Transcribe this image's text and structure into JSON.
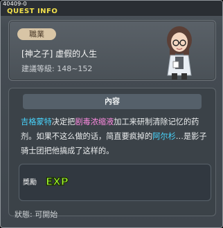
{
  "header": {
    "quest_id": "40409-0",
    "title": "QUEST INFO"
  },
  "quest": {
    "badge": "職業",
    "name": "[神之子] 虚假的人生",
    "level": "建議等級: 148~152"
  },
  "content": {
    "title": "內容",
    "desc": {
      "p1": "吉格蒙特",
      "p2": "决定把",
      "p3": "剧毒浓缩液",
      "p4": "加工来研制清除记忆的药剂。如果不这么做的话，简直要疯掉的",
      "p5": "阿尔杉",
      "p6": "…是影子骑士团把他搞成了这样的。"
    }
  },
  "reward": {
    "label": "獎勵",
    "exp_text": "EXP"
  },
  "status": "狀態: 可開始",
  "colors": {
    "highlight_blue": "#48d6ff",
    "highlight_pink": "#ff8be2",
    "title_yellow": "#f2e04b"
  }
}
